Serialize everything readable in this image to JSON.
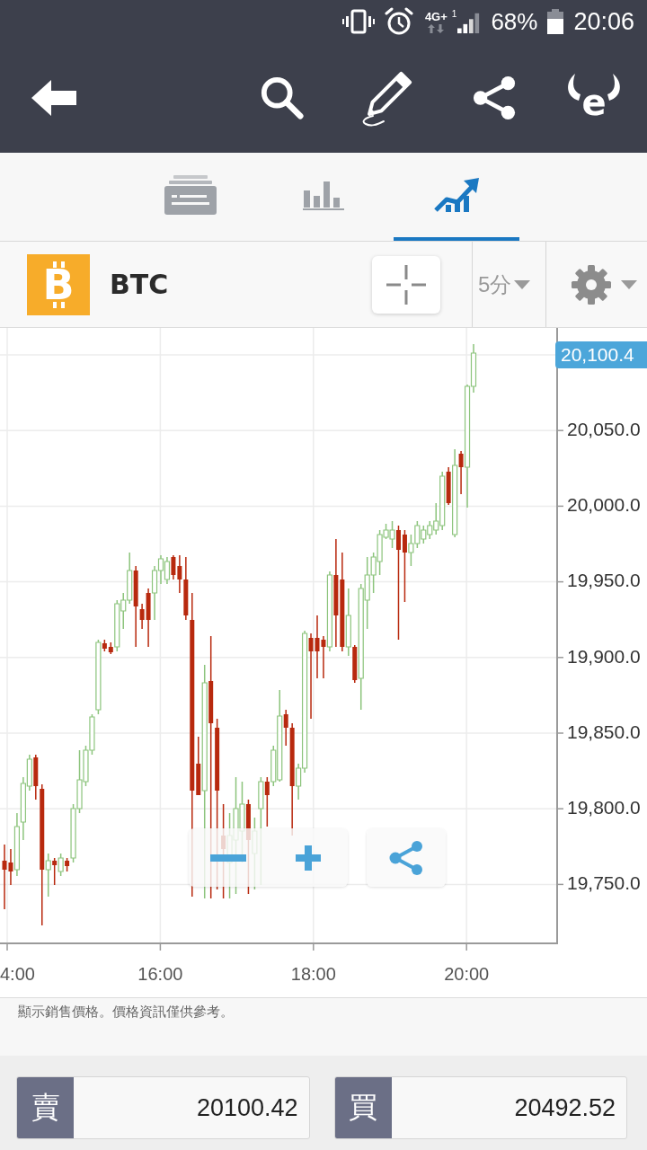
{
  "status_bar": {
    "network": "4G+",
    "sim_slot": "1",
    "battery": "68%",
    "time": "20:06"
  },
  "toolbar": {
    "logo_text": "e"
  },
  "tabs": [
    {
      "kind": "cards",
      "selected": false
    },
    {
      "kind": "stats",
      "selected": false
    },
    {
      "kind": "chart",
      "selected": true
    }
  ],
  "instrument": {
    "logo_text": "B",
    "symbol": "BTC",
    "interval": "5分"
  },
  "chart": {
    "last_price": "20,100.4",
    "y_labels": [
      "20,050.0",
      "20,000.0",
      "19,950.0",
      "19,900.0",
      "19,850.0",
      "19,800.0",
      "19,750.0"
    ],
    "x_labels": [
      "4:00",
      "16:00",
      "18:00",
      "20:00"
    ]
  },
  "disclaimer": "顯示銷售價格。價格資訊僅供參考。",
  "trade_buttons": [
    {
      "label": "賣",
      "price": "20100.42"
    },
    {
      "label": "買",
      "price": "20492.52"
    }
  ]
}
